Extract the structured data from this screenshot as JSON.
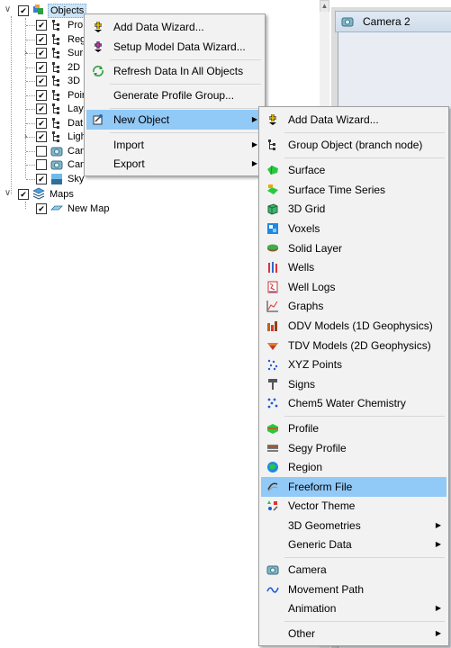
{
  "tree": {
    "root": "Objects",
    "children": [
      "Pro",
      "Reg",
      "Sur",
      "2D",
      "3D",
      "Poir",
      "Lay",
      "Dat",
      "Ligh",
      "Can",
      "Can",
      "Sky"
    ],
    "maps": "Maps",
    "map_child": "New Map"
  },
  "camera_tab": {
    "label": "Camera 2"
  },
  "context_menu": {
    "items": [
      "Add Data Wizard...",
      "Setup Model Data Wizard...",
      "Refresh Data In All Objects",
      "Generate Profile Group...",
      "New Object",
      "Import",
      "Export"
    ]
  },
  "new_object_menu": {
    "items": [
      "Add Data Wizard...",
      "Group Object (branch node)",
      "Surface",
      "Surface Time Series",
      "3D Grid",
      "Voxels",
      "Solid Layer",
      "Wells",
      "Well Logs",
      "Graphs",
      "ODV Models (1D Geophysics)",
      "TDV Models (2D Geophysics)",
      "XYZ Points",
      "Signs",
      "Chem5 Water Chemistry",
      "Profile",
      "Segy Profile",
      "Region",
      "Freeform File",
      "Vector Theme",
      "3D Geometries",
      "Generic Data",
      "Camera",
      "Movement Path",
      "Animation",
      "Other"
    ]
  },
  "colors": {
    "highlight": "#91c9f7",
    "selection": "#cce4f7",
    "menu_bg": "#f2f2f2"
  }
}
